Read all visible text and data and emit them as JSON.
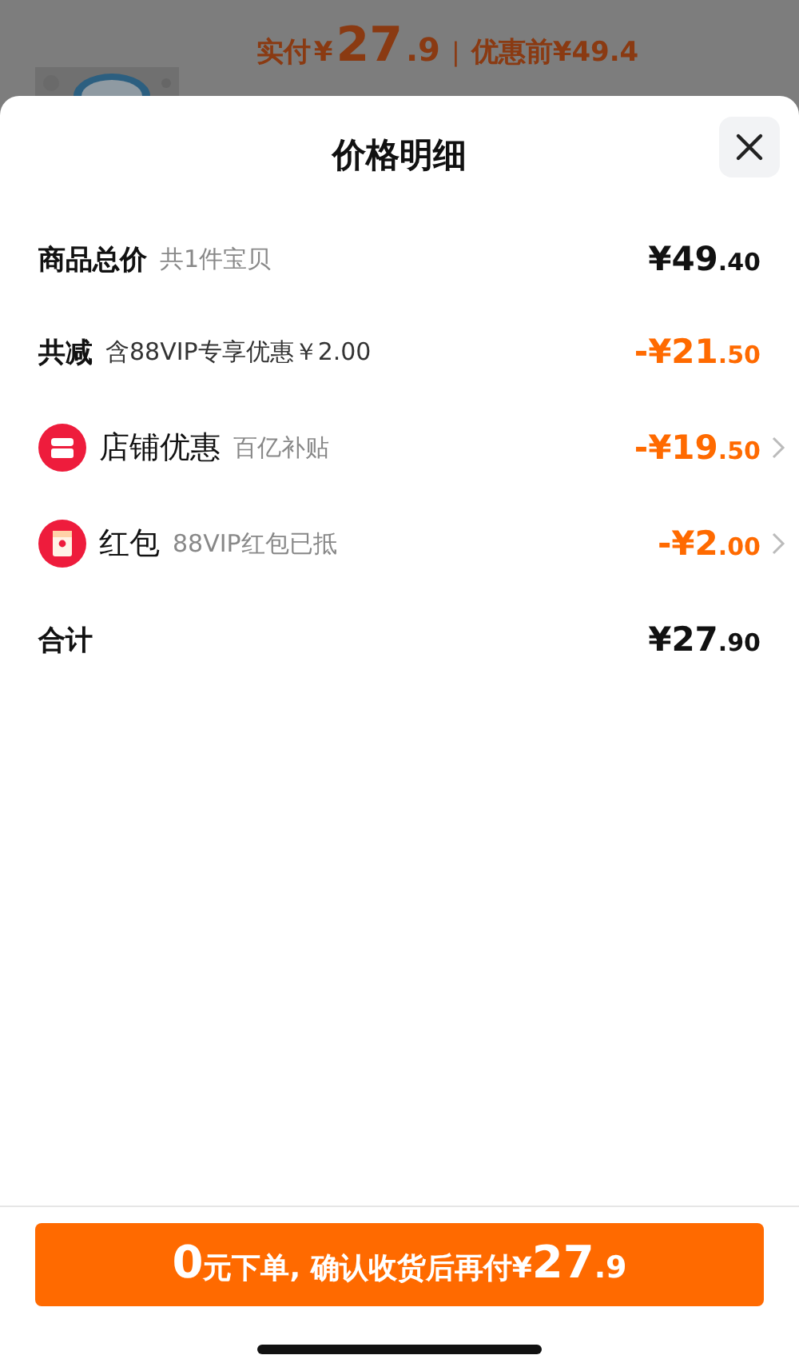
{
  "background_header": {
    "pieces": [
      {
        "text": "实付",
        "kind": "label"
      },
      {
        "text": "¥",
        "kind": "label"
      },
      {
        "text": "27",
        "kind": "big"
      },
      {
        "text": ".9",
        "kind": "mid"
      },
      {
        "text": "|",
        "kind": "sep"
      },
      {
        "text": "优惠前¥49.4",
        "kind": "label"
      }
    ]
  },
  "sheet": {
    "title": "价格明细",
    "rows": [
      {
        "kind": "plain",
        "label": "商品总价",
        "note": "共1件宝贝",
        "amount": "¥49.40",
        "discount": false,
        "link": false
      },
      {
        "kind": "plain",
        "label": "共减",
        "note": "含88VIP专享优惠￥2.00",
        "amount": "-¥21.50",
        "discount": true,
        "link": false
      },
      {
        "kind": "store",
        "label": "店铺优惠",
        "note": "百亿补贴",
        "amount": "-¥19.50",
        "discount": true,
        "link": true
      },
      {
        "kind": "redpacket",
        "label": "红包",
        "note": "88VIP红包已抵",
        "amount": "-¥2.00",
        "discount": true,
        "link": true
      },
      {
        "kind": "plain",
        "label": "合计",
        "amount": "¥27.90",
        "discount": false,
        "link": false
      }
    ],
    "pay_button": {
      "pieces": [
        {
          "text": "0",
          "kind": "big"
        },
        {
          "text": "元下单, 确认收货后再付",
          "kind": "label"
        },
        {
          "text": "¥",
          "kind": "label"
        },
        {
          "text": "27",
          "kind": "big"
        },
        {
          "text": ".9",
          "kind": "mid"
        }
      ]
    }
  }
}
